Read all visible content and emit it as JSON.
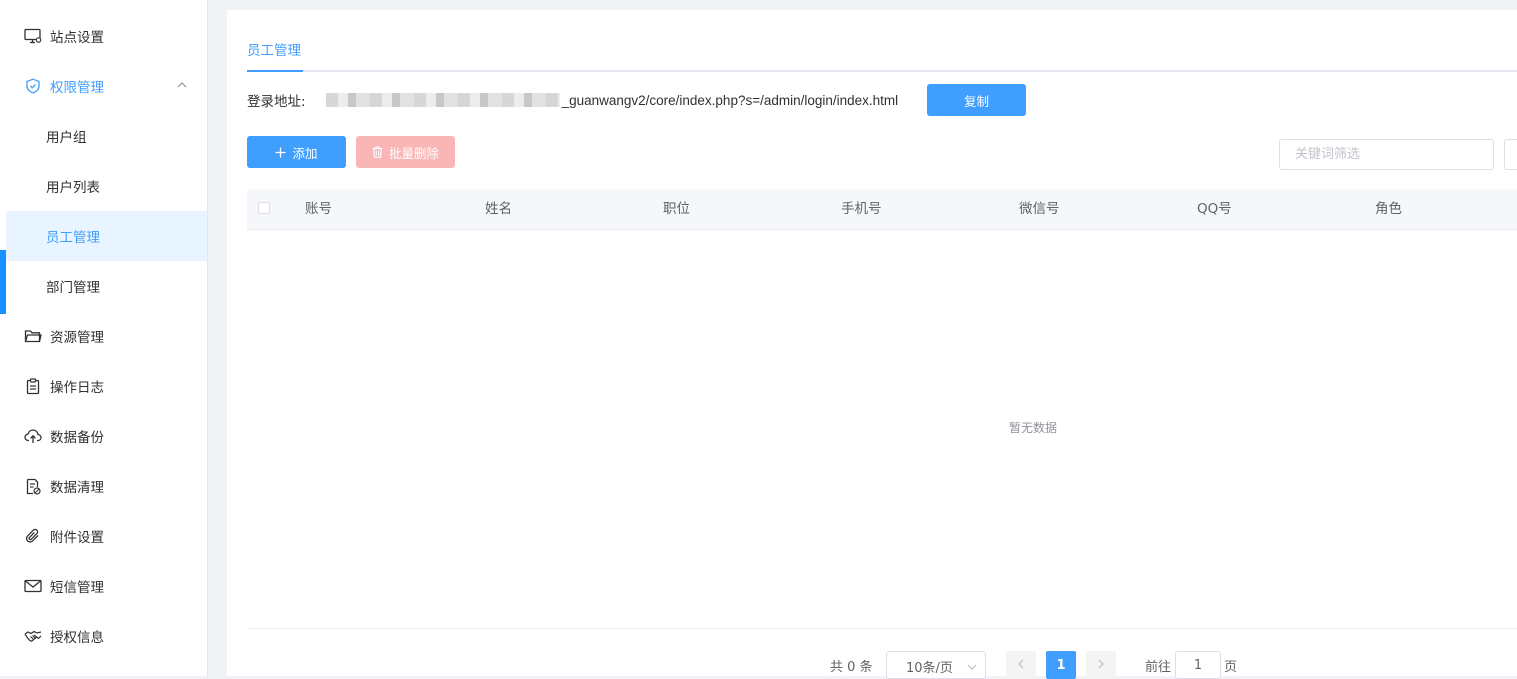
{
  "sidebar": {
    "items": [
      {
        "label": "站点设置",
        "icon": "monitor-icon"
      },
      {
        "label": "权限管理",
        "icon": "shield-icon"
      },
      {
        "label": "资源管理",
        "icon": "folder-icon"
      },
      {
        "label": "操作日志",
        "icon": "clipboard-icon"
      },
      {
        "label": "数据备份",
        "icon": "cloud-upload-icon"
      },
      {
        "label": "数据清理",
        "icon": "document-clean-icon"
      },
      {
        "label": "附件设置",
        "icon": "paperclip-icon"
      },
      {
        "label": "短信管理",
        "icon": "mail-icon"
      },
      {
        "label": "授权信息",
        "icon": "handshake-icon"
      }
    ],
    "sub_items": [
      {
        "label": "用户组"
      },
      {
        "label": "用户列表"
      },
      {
        "label": "员工管理"
      },
      {
        "label": "部门管理"
      }
    ]
  },
  "main": {
    "tab": "员工管理",
    "login_label": "登录地址:",
    "login_url": "_guanwangv2/core/index.php?s=/admin/login/index.html",
    "copy_button": "复制",
    "add_button": "添加",
    "batch_delete_button": "批量删除",
    "search_placeholder": "关键词筛选",
    "table": {
      "columns": [
        "账号",
        "姓名",
        "职位",
        "手机号",
        "微信号",
        "QQ号",
        "角色"
      ],
      "empty_text": "暂无数据"
    },
    "pagination": {
      "total": "共 0 条",
      "page_size": "10条/页",
      "current_page": "1",
      "goto_label": "前往",
      "goto_value": "1",
      "page_unit": "页"
    }
  },
  "colors": {
    "primary": "#409eff",
    "danger_disabled": "#fab6b6",
    "sidebar_active_bar": "#1890ff",
    "submenu_selected_bg": "#e8f4ff"
  }
}
